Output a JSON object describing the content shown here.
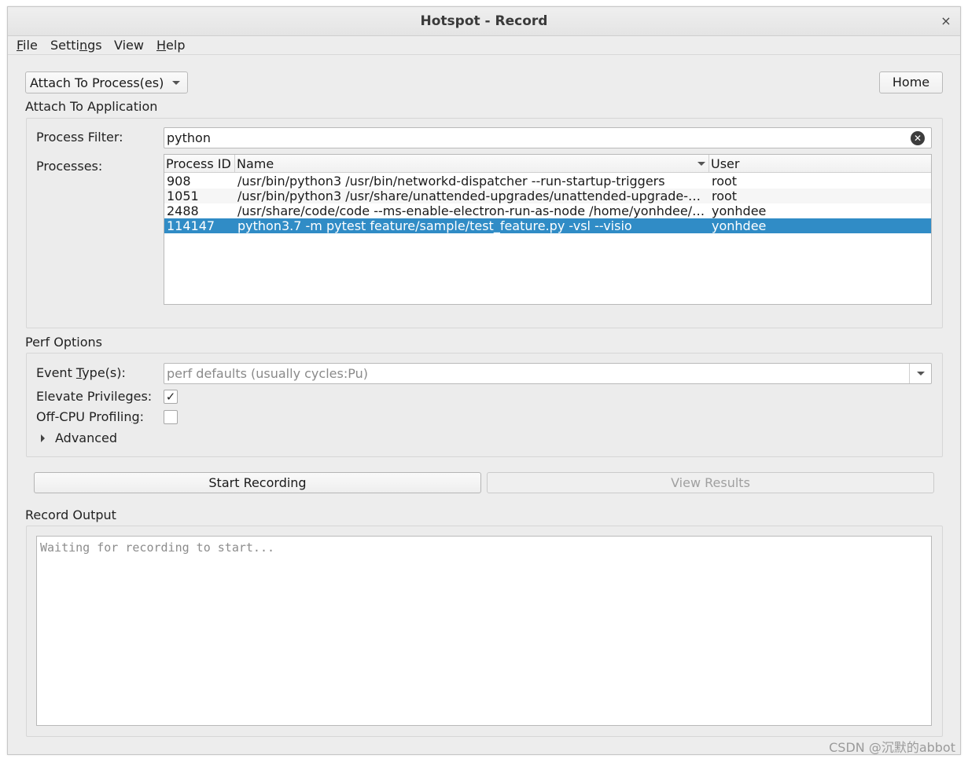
{
  "window": {
    "title": "Hotspot - Record",
    "close_glyph": "×"
  },
  "menu": [
    {
      "label": "File"
    },
    {
      "label": "Settings"
    },
    {
      "label": "View"
    },
    {
      "label": "Help"
    }
  ],
  "mode_select": {
    "value": "Attach To Process(es)"
  },
  "home_button": "Home",
  "attach_section": {
    "title": "Attach To Application",
    "filter_label": "Process Filter:",
    "filter_value": "python",
    "processes_label": "Processes:",
    "columns": [
      "Process ID",
      "Name",
      "User"
    ],
    "rows": [
      {
        "pid": "908",
        "name": "/usr/bin/python3 /usr/bin/networkd-dispatcher --run-startup-triggers",
        "user": "root",
        "selected": false
      },
      {
        "pid": "1051",
        "name": "/usr/bin/python3 /usr/share/unattended-upgrades/unattended-upgrade-…",
        "user": "root",
        "selected": false
      },
      {
        "pid": "2488",
        "name": "/usr/share/code/code --ms-enable-electron-run-as-node /home/yonhdee/…",
        "user": "yonhdee",
        "selected": false
      },
      {
        "pid": "114147",
        "name": "python3.7 -m pytest feature/sample/test_feature.py -vsl --visio",
        "user": "yonhdee",
        "selected": true
      }
    ]
  },
  "perf_options": {
    "title": "Perf Options",
    "event_label": "Event Type(s):",
    "event_placeholder": "perf defaults (usually cycles:Pu)",
    "elevate_label": "Elevate Privileges:",
    "elevate_checked": true,
    "offcpu_label": "Off-CPU Profiling:",
    "offcpu_checked": false,
    "advanced_label": "Advanced"
  },
  "actions": {
    "start": "Start Recording",
    "view_results": "View Results"
  },
  "record_output": {
    "title": "Record Output",
    "placeholder": "Waiting for recording to start..."
  },
  "watermark": "CSDN @沉默的abbot",
  "colors": {
    "selection": "#308cc6",
    "window_bg": "#ededed"
  }
}
